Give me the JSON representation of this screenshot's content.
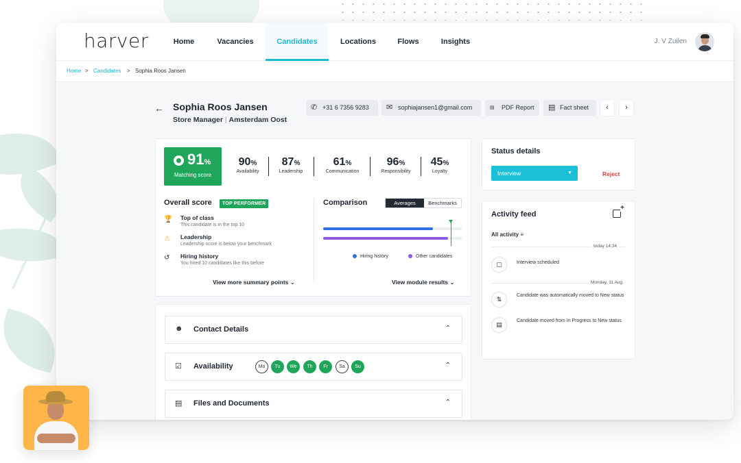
{
  "app": {
    "logo": "harver"
  },
  "nav": {
    "items": [
      "Home",
      "Vacancies",
      "Candidates",
      "Locations",
      "Flows",
      "Insights"
    ],
    "active": "Candidates"
  },
  "user": {
    "name": "J. V Zuilen"
  },
  "breadcrumb": {
    "home": "Home",
    "candidates": "Candidates",
    "sep": ">",
    "current": "Sophia Roos Jansen"
  },
  "candidate": {
    "name": "Sophia Roos Jansen",
    "role": "Store Manager",
    "location": "Amsterdam Oost",
    "phone": "+31 6 7356 9283",
    "email": "sophiajansen1@gmail.com",
    "pdf_label": "PDF Report",
    "fact_label": "Fact sheet"
  },
  "scores": {
    "matching_value": "91",
    "matching_label": "Matching score",
    "unit": "%",
    "metrics": [
      {
        "value": "90",
        "label": "Availability"
      },
      {
        "value": "87",
        "label": "Leadership"
      },
      {
        "value": "61",
        "label": "Communication"
      },
      {
        "value": "96",
        "label": "Responsibility"
      },
      {
        "value": "45",
        "label": "Loyalty"
      }
    ]
  },
  "overall": {
    "title": "Overall score",
    "badge": "TOP PERFORMER",
    "points": [
      {
        "icon": "trophy-icon",
        "title": "Top of class",
        "desc": "This candidate is in the top 10"
      },
      {
        "icon": "warning-icon",
        "title": "Leadership",
        "desc": "Leadership score is below your benchmark"
      },
      {
        "icon": "history-icon",
        "title": "Hiring history",
        "desc": "You hired 10 candidates like this before"
      }
    ],
    "more": "View more summary points"
  },
  "comparison": {
    "title": "Comparison",
    "tabs": [
      "Averages",
      "Benchmarks"
    ],
    "active_tab": "Averages",
    "hiring_history_level": 0.79,
    "other_candidates_level": 0.9,
    "benchmark_level": 0.92,
    "legend": [
      "Hiring history",
      "Other candidates"
    ],
    "colors": {
      "hiring": "#2f6fe0",
      "other": "#8a5be0",
      "benchmark": "#1fa65a"
    },
    "more": "View module results"
  },
  "status": {
    "title": "Status details",
    "value": "Interview",
    "reject": "Reject"
  },
  "activity": {
    "title": "Activity feed",
    "filter": "All activity",
    "groups": [
      {
        "date": "today 14:34",
        "items": [
          {
            "icon": "note-icon",
            "text": "Interview scheduled"
          }
        ]
      },
      {
        "date": "Monday, 11 Aug.",
        "items": [
          {
            "icon": "auto-move-icon",
            "text": "Candidate was automatically moved to New status"
          },
          {
            "icon": "document-icon",
            "text": "Candidate moved from In Progress to New status"
          }
        ]
      }
    ]
  },
  "sections": {
    "contact": "Contact Details",
    "availability": "Availability",
    "files": "Files and Documents",
    "days": [
      {
        "label": "Mo",
        "on": false
      },
      {
        "label": "Tu",
        "on": true
      },
      {
        "label": "We",
        "on": true
      },
      {
        "label": "Th",
        "on": true
      },
      {
        "label": "Fr",
        "on": true
      },
      {
        "label": "Sa",
        "on": false
      },
      {
        "label": "Su",
        "on": true
      }
    ]
  },
  "colors": {
    "accent": "#1bb8cf",
    "success": "#1fa65a",
    "danger": "#e23b3b"
  }
}
